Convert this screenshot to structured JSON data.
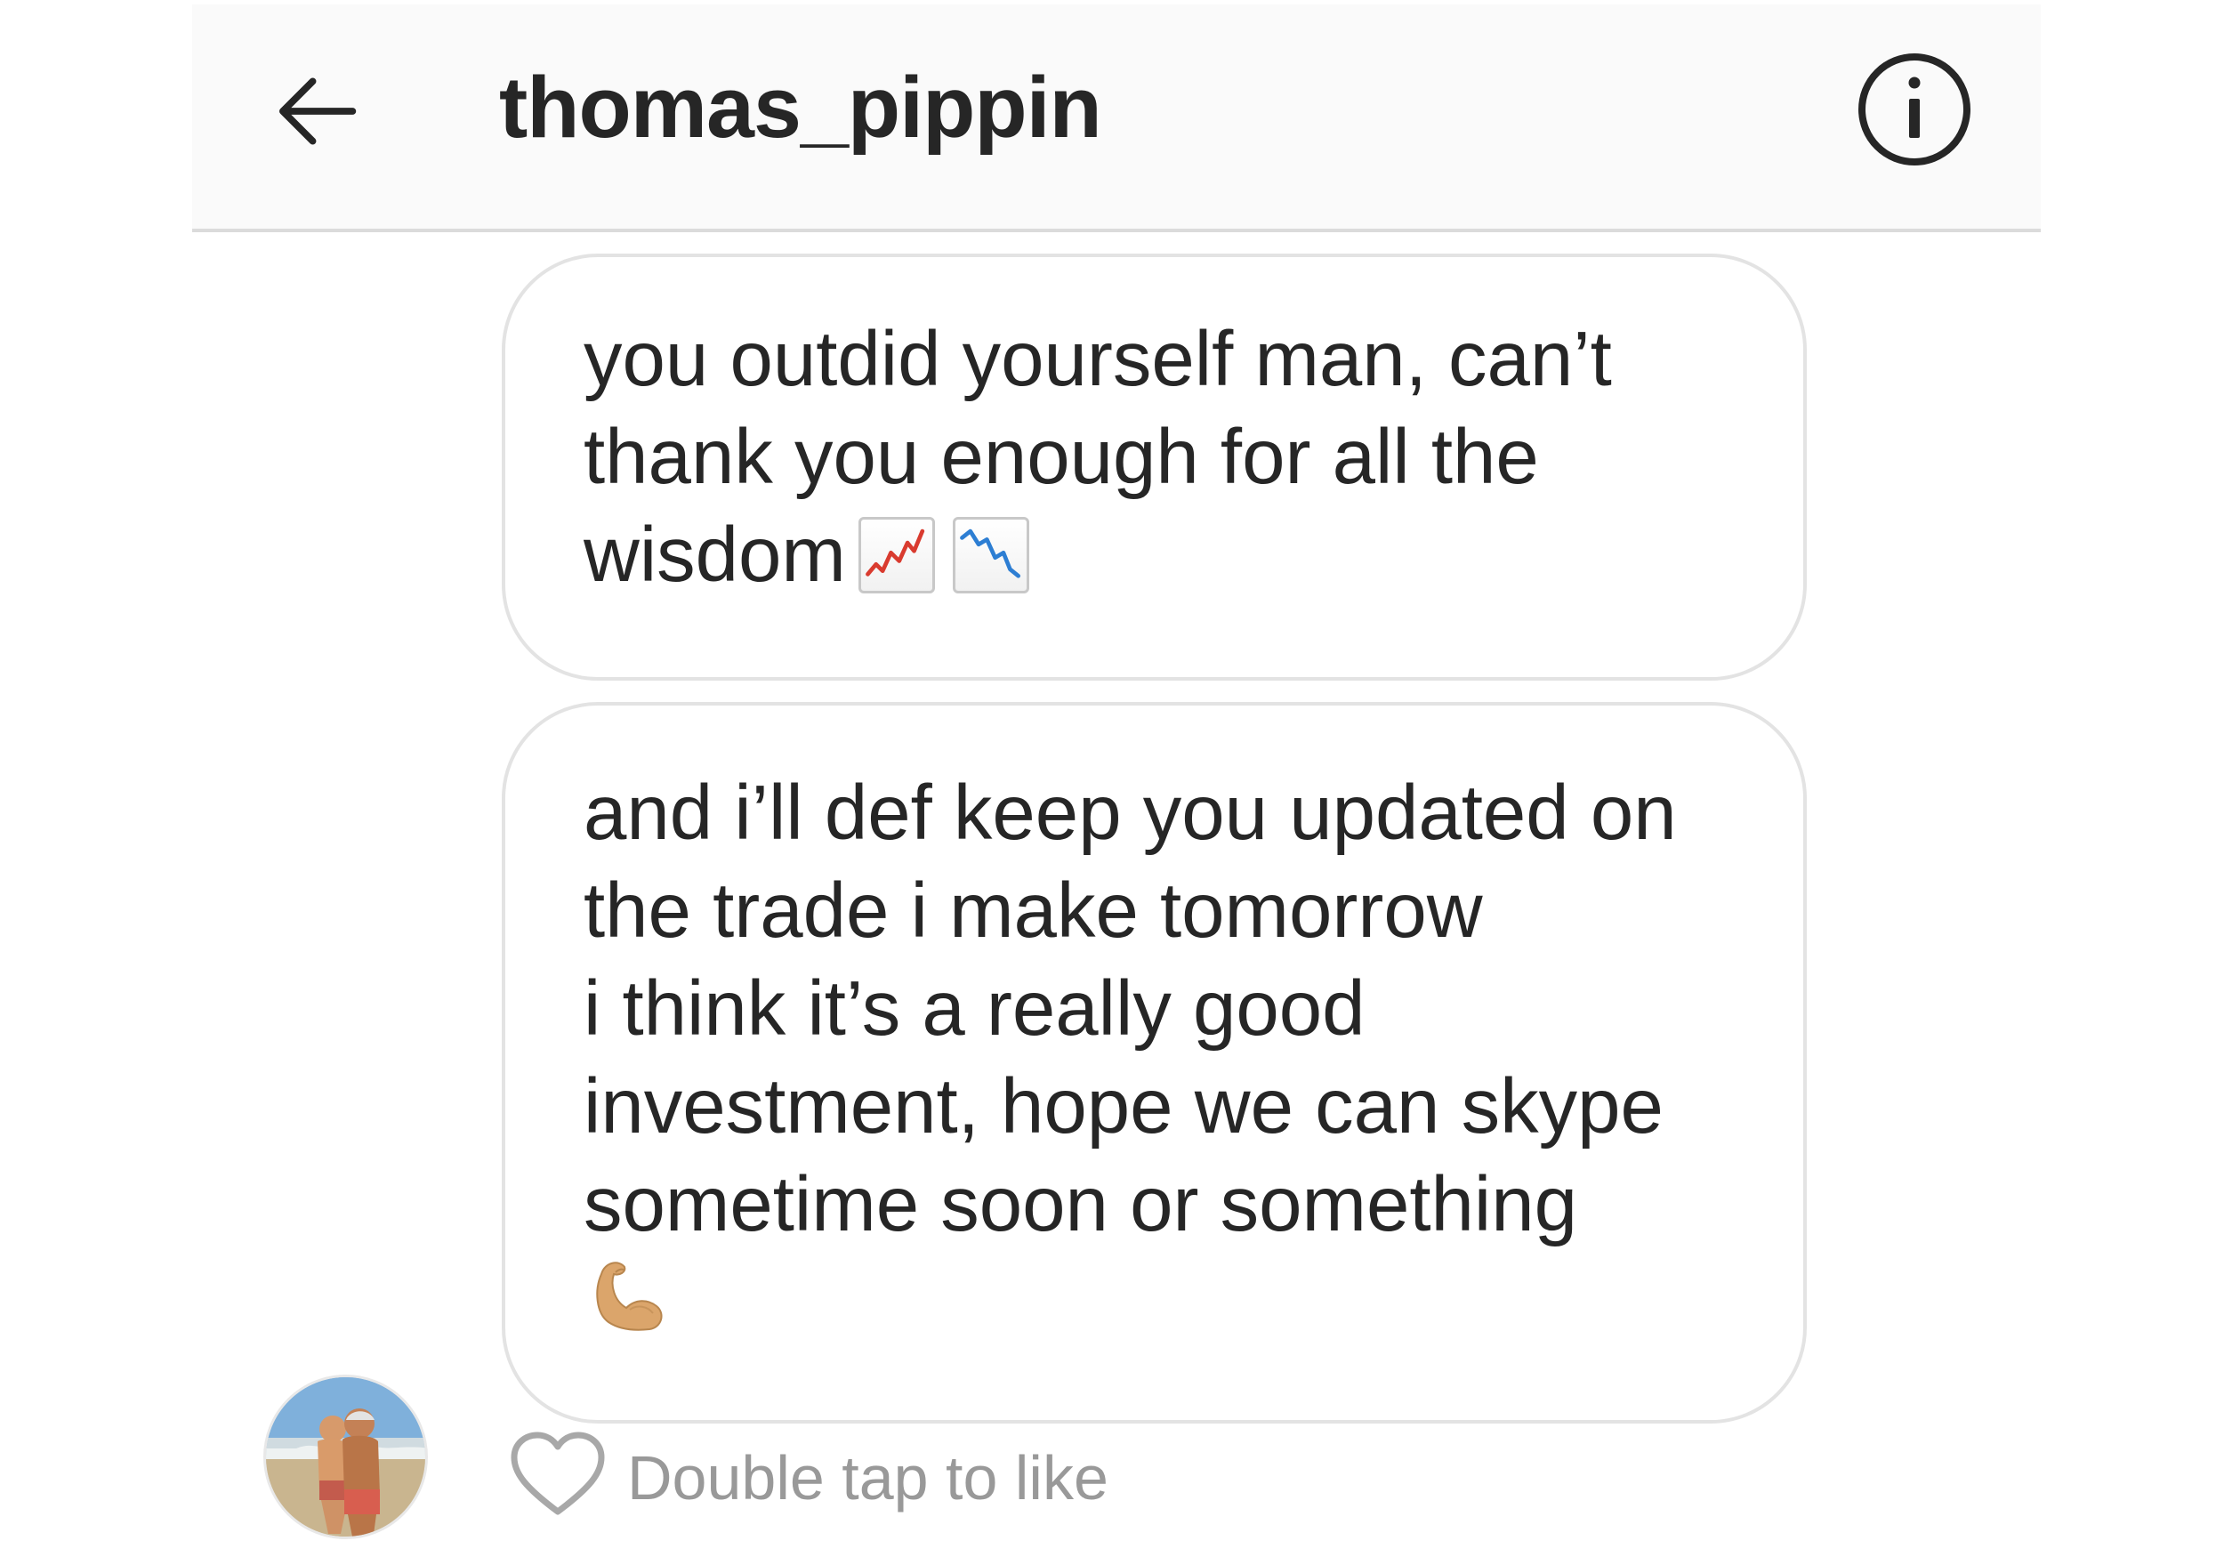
{
  "header": {
    "title": "thomas_pippin",
    "back_icon": "arrow-left-icon",
    "info_icon": "info-circle-icon"
  },
  "messages": [
    {
      "text": "you outdid yourself man, can’t thank you enough for all the wisdom",
      "emojis": [
        "chart-increasing-icon",
        "chart-decreasing-icon"
      ]
    },
    {
      "text": "and i’ll def keep you updated on the trade i make tomorrow\ni think it’s a really good investment, hope we can skype sometime soon or something",
      "emojis": [
        "flexed-biceps-icon"
      ]
    }
  ],
  "footer": {
    "like_text": "Double tap to like",
    "like_icon": "heart-outline-icon",
    "avatar_icon": "profile-avatar"
  },
  "colors": {
    "header_bg": "#fafafa",
    "bubble_border": "#e3e3e3",
    "text_primary": "#262626",
    "text_secondary": "#999999",
    "chart_up": "#d93b2f",
    "chart_down": "#2d7ed3",
    "biceps": "#dba56b"
  }
}
